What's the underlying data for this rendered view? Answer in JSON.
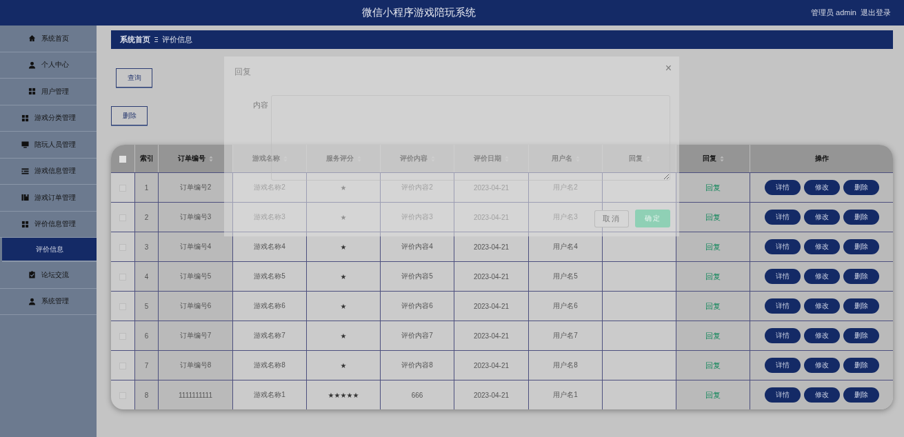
{
  "header": {
    "title": "微信小程序游戏陪玩系统",
    "user": "管理员 admin",
    "logout": "退出登录"
  },
  "sidebar": {
    "items": [
      {
        "label": "系统首页",
        "selected": false
      },
      {
        "label": "个人中心",
        "selected": false
      },
      {
        "label": "用户管理",
        "selected": false
      },
      {
        "label": "游戏分类管理",
        "selected": false
      },
      {
        "label": "陪玩人员管理",
        "selected": false
      },
      {
        "label": "游戏信息管理",
        "selected": false
      },
      {
        "label": "游戏订单管理",
        "selected": false
      },
      {
        "label": "评价信息管理",
        "selected": false,
        "expanded": true,
        "children": [
          {
            "label": "评价信息",
            "selected": true
          }
        ]
      },
      {
        "label": "论坛交流",
        "selected": false
      },
      {
        "label": "系统管理",
        "selected": false
      }
    ]
  },
  "breadcrumb": [
    "系统首页",
    "评价信息"
  ],
  "search_button": "查询",
  "delete_button": "删除",
  "table": {
    "select_all": {
      "checked": false
    },
    "columns": [
      {
        "label": "索引",
        "sortable": false
      },
      {
        "label": "订单编号",
        "sortable": true
      },
      {
        "label": "游戏名称",
        "sortable": true
      },
      {
        "label": "服务评分",
        "sortable": true
      },
      {
        "label": "评价内容",
        "sortable": true
      },
      {
        "label": "评价日期",
        "sortable": true
      },
      {
        "label": "用户名",
        "sortable": true
      },
      {
        "label": "回复",
        "sortable": true
      },
      {
        "label": "回复",
        "sortable": true
      },
      {
        "label": "操作",
        "sortable": false
      }
    ],
    "rows": [
      {
        "checked": false,
        "index": "1",
        "order_no": "订单编号2",
        "game": "游戏名称2",
        "rating": "★",
        "content": "评价内容2",
        "date": "2023-04-21",
        "user": "用户名2",
        "reply_link": "回复",
        "actions": [
          "详情",
          "修改",
          "删除"
        ]
      },
      {
        "checked": false,
        "index": "2",
        "order_no": "订单编号3",
        "game": "游戏名称3",
        "rating": "★",
        "content": "评价内容3",
        "date": "2023-04-21",
        "user": "用户名3",
        "reply_link": "回复",
        "actions": [
          "详情",
          "修改",
          "删除"
        ]
      },
      {
        "checked": false,
        "index": "3",
        "order_no": "订单编号4",
        "game": "游戏名称4",
        "rating": "★",
        "content": "评价内容4",
        "date": "2023-04-21",
        "user": "用户名4",
        "reply_link": "回复",
        "actions": [
          "详情",
          "修改",
          "删除"
        ]
      },
      {
        "checked": false,
        "index": "4",
        "order_no": "订单编号5",
        "game": "游戏名称5",
        "rating": "★",
        "content": "评价内容5",
        "date": "2023-04-21",
        "user": "用户名5",
        "reply_link": "回复",
        "actions": [
          "详情",
          "修改",
          "删除"
        ]
      },
      {
        "checked": false,
        "index": "5",
        "order_no": "订单编号6",
        "game": "游戏名称6",
        "rating": "★",
        "content": "评价内容6",
        "date": "2023-04-21",
        "user": "用户名6",
        "reply_link": "回复",
        "actions": [
          "详情",
          "修改",
          "删除"
        ]
      },
      {
        "checked": false,
        "index": "6",
        "order_no": "订单编号7",
        "game": "游戏名称7",
        "rating": "★",
        "content": "评价内容7",
        "date": "2023-04-21",
        "user": "用户名7",
        "reply_link": "回复",
        "actions": [
          "详情",
          "修改",
          "删除"
        ]
      },
      {
        "checked": false,
        "index": "7",
        "order_no": "订单编号8",
        "game": "游戏名称8",
        "rating": "★",
        "content": "评价内容8",
        "date": "2023-04-21",
        "user": "用户名8",
        "reply_link": "回复",
        "actions": [
          "详情",
          "修改",
          "删除"
        ]
      },
      {
        "checked": false,
        "index": "8",
        "order_no": "1111111111",
        "game": "游戏名称1",
        "rating": "★★★★★",
        "content": "666",
        "date": "2023-04-21",
        "user": "用户名1",
        "reply_link": "回复",
        "actions": [
          "详情",
          "修改",
          "删除"
        ]
      }
    ]
  },
  "dialog": {
    "title": "回复",
    "close": "×",
    "field_label": "内容",
    "buttons": [
      "取消",
      "确定"
    ]
  }
}
